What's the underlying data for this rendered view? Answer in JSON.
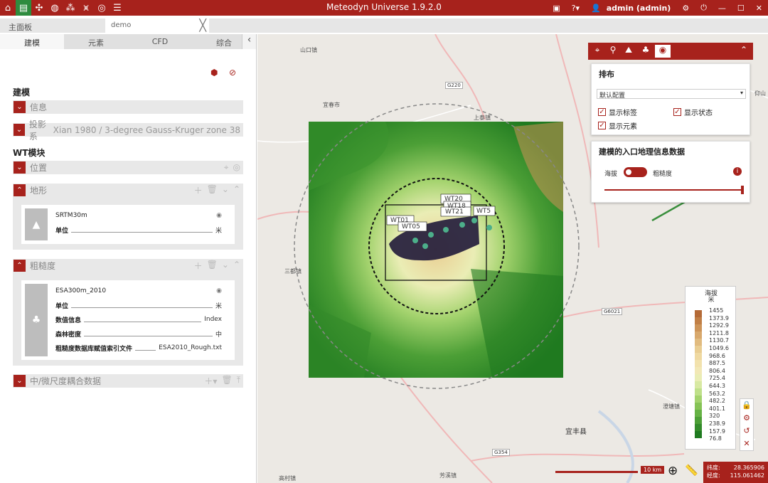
{
  "window": {
    "title": "Meteodyn Universe 1.9.2.0",
    "user": "admin (admin)",
    "toolbar_icons": [
      "home-icon",
      "clipboard-icon",
      "turbine-icon",
      "globe-icon",
      "network-icon",
      "platform-icon",
      "target-icon",
      "menu-icon"
    ]
  },
  "tabs": {
    "main": "主面板",
    "doc": "demo"
  },
  "subtabs": [
    "建模",
    "元素",
    "CFD",
    "综合"
  ],
  "left": {
    "modeling_title": "建模",
    "info_label": "信息",
    "projection_label": "投影系",
    "projection_value": "Xian 1980 / 3-degree Gauss-Kruger zone 38",
    "wt_title": "WT模块",
    "position_label": "位置",
    "terrain_label": "地形",
    "terrain_card": {
      "name": "SRTM30m",
      "unit_key": "单位",
      "unit_val": "米"
    },
    "roughness_label": "粗糙度",
    "roughness_card": {
      "name": "ESA300m_2010",
      "rows": [
        {
          "k": "单位",
          "v": "米"
        },
        {
          "k": "数值信息",
          "v": "Index"
        },
        {
          "k": "森林密度",
          "v": "中"
        },
        {
          "k": "粗糙度数据库赋值索引文件",
          "v": "ESA2010_Rough.txt"
        }
      ]
    },
    "coupling_label": "中/微尺度耦合数据"
  },
  "layout_panel": {
    "title": "排布",
    "select_value": "默认配置",
    "checkboxes": [
      "显示标签",
      "显示状态",
      "显示元素"
    ]
  },
  "gis_panel": {
    "title": "建模的入口地理信息数据",
    "left_label": "海拔",
    "right_label": "粗糙度"
  },
  "legend": {
    "title": "海拔",
    "unit": "米",
    "values": [
      "1455",
      "1373.9",
      "1292.9",
      "1211.8",
      "1130.7",
      "1049.6",
      "968.6",
      "887.5",
      "806.4",
      "725.4",
      "644.3",
      "563.2",
      "482.2",
      "401.1",
      "320",
      "238.9",
      "157.9",
      "76.8"
    ],
    "colors": [
      "#b46a37",
      "#c17f46",
      "#cd9458",
      "#d8a86c",
      "#e1bb7f",
      "#e9cd92",
      "#efd9a1",
      "#f2e2ad",
      "#f2e8b6",
      "#eaedb5",
      "#d8e9a3",
      "#bfe08a",
      "#a4d36e",
      "#86c356",
      "#66b245",
      "#4c9f36",
      "#338b2a",
      "#1f7a20"
    ]
  },
  "map": {
    "scale_label": "10 km",
    "lat_label": "纬度:",
    "lat_value": "28.365906",
    "lon_label": "经度:",
    "lon_value": "115.061462",
    "place_labels": [
      "山口镇",
      "G220",
      "宜春市",
      "上泰镇",
      "G6021",
      "三都镇",
      "宜丰县",
      "G354",
      "澄塘镇",
      "芳溪镇",
      "高村镇",
      "仰山"
    ],
    "turbine_labels": [
      "WT01",
      "WT05",
      "WT21",
      "WT20",
      "WT18",
      "WT5"
    ]
  },
  "colors": {
    "brand": "#a7221c",
    "accent_green": "#2e8b3e",
    "arrow_green": "#3a8f3d"
  }
}
